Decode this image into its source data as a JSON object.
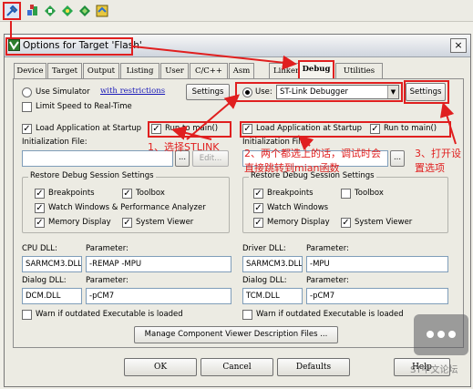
{
  "window": {
    "title": "Options for Target 'Flash'",
    "close_label": "×"
  },
  "toolbar": {
    "icons": [
      "options-for-target-icon",
      "load-icon",
      "download-icon",
      "manage-components-icon",
      "build-icon",
      "rebuild-icon"
    ]
  },
  "tabs": [
    "Device",
    "Target",
    "Output",
    "Listing",
    "User",
    "C/C++",
    "Asm",
    "Linker",
    "Debug",
    "Utilities"
  ],
  "active_tab": "Debug",
  "left": {
    "use_simulator": "Use Simulator",
    "with_restrictions": "with restrictions",
    "settings": "Settings",
    "limit_speed": "Limit Speed to Real-Time",
    "load_app": "Load Application at Startup",
    "run_to_main": "Run to main()",
    "init_file_label": "Initialization File:",
    "browse": "...",
    "edit": "Edit...",
    "restore_group": "Restore Debug Session Settings",
    "breakpoints": "Breakpoints",
    "toolbox": "Toolbox",
    "watch_windows": "Watch Windows & Performance Analyzer",
    "memory_display": "Memory Display",
    "system_viewer": "System Viewer",
    "cpu_dll_label": "CPU DLL:",
    "cpu_dll": "SARMCM3.DLL",
    "parameter_label": "Parameter:",
    "cpu_param": "-REMAP -MPU",
    "dialog_dll_label": "Dialog DLL:",
    "dialog_dll": "DCM.DLL",
    "dialog_param": "-pCM7",
    "warn": "Warn if outdated Executable is loaded"
  },
  "right": {
    "use": "Use:",
    "debugger": "ST-Link Debugger",
    "settings": "Settings",
    "load_app": "Load Application at Startup",
    "run_to_main": "Run to main()",
    "init_file_label": "Initialization File:",
    "browse": "...",
    "restore_group": "Restore Debug Session Settings",
    "breakpoints": "Breakpoints",
    "toolbox": "Toolbox",
    "watch_windows": "Watch Windows",
    "memory_display": "Memory Display",
    "system_viewer": "System Viewer",
    "driver_dll_label": "Driver DLL:",
    "driver_dll": "SARMCM3.DLL",
    "parameter_label": "Parameter:",
    "driver_param": "-MPU",
    "dialog_dll_label": "Dialog DLL:",
    "dialog_dll": "TCM.DLL",
    "dialog_param": "-pCM7",
    "warn": "Warn if outdated Executable is loaded"
  },
  "manage_button": "Manage Component Viewer Description Files ...",
  "buttons": {
    "ok": "OK",
    "cancel": "Cancel",
    "defaults": "Defaults",
    "help": "Help"
  },
  "annotations": {
    "a1": "1、选择STLINK",
    "a2_line1": "2、两个都选上的话，调试时会",
    "a2_line2": "直接跳转到mian函数",
    "a3_line1": "3、打开设",
    "a3_line2": "置选项"
  },
  "watermark": "ST中文论坛",
  "colors": {
    "annotation_red": "#e01f1f",
    "link_blue": "#1a1ab8",
    "dialog_bg": "#ecebe3"
  }
}
